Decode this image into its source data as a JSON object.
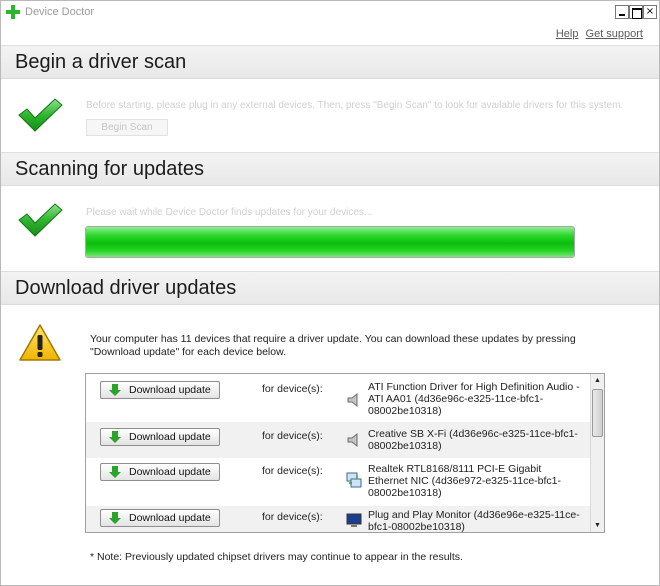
{
  "window": {
    "title": "Device Doctor",
    "minimize_label": "_",
    "maximize_label": "",
    "close_label": "×"
  },
  "links": {
    "help": "Help",
    "support": "Get support"
  },
  "sections": {
    "scan": {
      "title": "Begin a driver scan",
      "hint": "Before starting, please plug in any external devices. Then, press \"Begin Scan\" to look for available drivers for this system.",
      "button": "Begin Scan"
    },
    "updates": {
      "title": "Scanning for updates",
      "hint": "Please wait while Device Doctor finds updates for your devices...",
      "progress_fraction": 1.0
    },
    "download": {
      "title": "Download driver updates",
      "intro": "Your computer has 11 devices that require a driver update. You can download these updates by pressing \"Download update\" for each device below.",
      "note": "* Note: Previously updated chipset drivers may continue to appear in the results."
    }
  },
  "devices": [
    {
      "button": "Download update",
      "for_label": "for device(s):",
      "icon": "speaker-icon",
      "name": "ATI Function Driver for High Definition Audio - ATI AA01 (4d36e96c-e325-11ce-bfc1-08002be10318)"
    },
    {
      "button": "Download update",
      "for_label": "for device(s):",
      "icon": "speaker-icon",
      "name": "Creative SB X-Fi (4d36e96c-e325-11ce-bfc1-08002be10318)"
    },
    {
      "button": "Download update",
      "for_label": "for device(s):",
      "icon": "network-icon",
      "name": "Realtek RTL8168/8111 PCI-E Gigabit Ethernet NIC (4d36e972-e325-11ce-bfc1-08002be10318)"
    },
    {
      "button": "Download update",
      "for_label": "for device(s):",
      "icon": "monitor-icon",
      "name": "Plug and Play Monitor (4d36e96e-e325-11ce-bfc1-08002be10318)"
    }
  ],
  "colors": {
    "accent_green": "#14c314",
    "warning_yellow": "#f7c21b"
  }
}
